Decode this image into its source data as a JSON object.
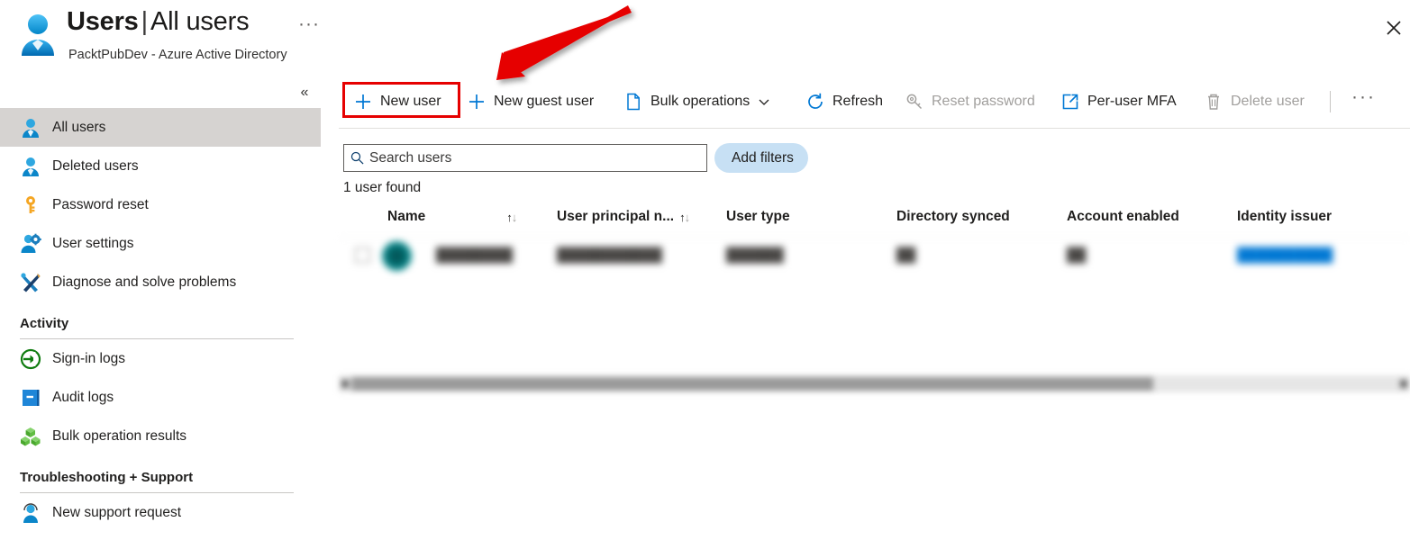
{
  "header": {
    "title_main": "Users",
    "title_separator": "|",
    "title_sub": "All users",
    "subtitle": "PacktPubDev - Azure Active Directory",
    "more_label": "···",
    "close_label": "✕",
    "collapse_label": "«",
    "avatar_icon": "user-avatar-icon"
  },
  "sidebar": {
    "items": [
      {
        "label": "All users",
        "icon": "user-icon",
        "selected": true
      },
      {
        "label": "Deleted users",
        "icon": "user-deleted-icon",
        "selected": false
      },
      {
        "label": "Password reset",
        "icon": "key-icon",
        "selected": false
      },
      {
        "label": "User settings",
        "icon": "user-gear-icon",
        "selected": false
      },
      {
        "label": "Diagnose and solve problems",
        "icon": "wrench-screwdriver-icon",
        "selected": false
      }
    ],
    "groups": [
      {
        "title": "Activity",
        "items": [
          {
            "label": "Sign-in logs",
            "icon": "sign-in-arrow-icon"
          },
          {
            "label": "Audit logs",
            "icon": "book-icon"
          },
          {
            "label": "Bulk operation results",
            "icon": "cubes-icon"
          }
        ]
      },
      {
        "title": "Troubleshooting + Support",
        "items": [
          {
            "label": "New support request",
            "icon": "support-person-icon"
          }
        ]
      }
    ]
  },
  "command_bar": {
    "items": [
      {
        "label": "New user",
        "icon": "plus-icon",
        "disabled": false,
        "highlighted": true
      },
      {
        "label": "New guest user",
        "icon": "plus-icon",
        "disabled": false,
        "highlighted": false
      },
      {
        "label": "Bulk operations",
        "icon": "document-icon",
        "disabled": false,
        "has_chevron": true
      },
      {
        "label": "Refresh",
        "icon": "refresh-icon",
        "disabled": false
      },
      {
        "label": "Reset password",
        "icon": "key-outline-icon",
        "disabled": true
      },
      {
        "label": "Per-user MFA",
        "icon": "external-link-icon",
        "disabled": false
      },
      {
        "label": "Delete user",
        "icon": "trash-icon",
        "disabled": true
      }
    ],
    "overflow_label": "···"
  },
  "search": {
    "placeholder": "Search users",
    "value": "",
    "icon": "search-icon"
  },
  "filters": {
    "add_filters_label": "Add filters",
    "icon": "add-filter-icon"
  },
  "results": {
    "count_text": "1 user found"
  },
  "table": {
    "columns": [
      {
        "label": "Name",
        "sortable": true
      },
      {
        "label": "User principal n...",
        "sortable": true
      },
      {
        "label": "User type",
        "sortable": false
      },
      {
        "label": "Directory synced",
        "sortable": false
      },
      {
        "label": "Account enabled",
        "sortable": false
      },
      {
        "label": "Identity issuer",
        "sortable": false
      }
    ],
    "sort_up_glyph": "↑",
    "sort_down_glyph": "↓",
    "rows": [
      {
        "redacted": true,
        "name": "████████",
        "user_principal_name": "███████████",
        "user_type": "██████",
        "directory_synced": "██",
        "account_enabled": "██",
        "identity_issuer": "██████████"
      }
    ]
  },
  "annotation": {
    "arrow_color": "#e60000",
    "highlight_color": "#e60000",
    "target": "New user"
  },
  "colors": {
    "accent_blue": "#0078d4",
    "selection_gray": "#d6d3d1",
    "disabled_text": "#a19f9d",
    "filter_pill": "#c7e0f4"
  }
}
